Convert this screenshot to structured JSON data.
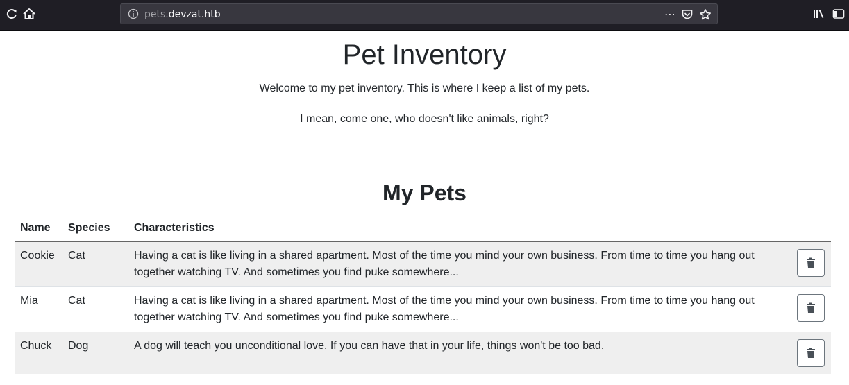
{
  "browser": {
    "url_host_prefix": "pets.",
    "url_host_domain": "devzat.htb",
    "more_actions": "⋯"
  },
  "page": {
    "title": "Pet Inventory",
    "intro_line1": "Welcome to my pet inventory. This is where I keep a list of my pets.",
    "intro_line2": "I mean, come one, who doesn't like animals, right?",
    "section_title": "My Pets"
  },
  "table": {
    "headers": [
      "Name",
      "Species",
      "Characteristics"
    ],
    "rows": [
      {
        "name": "Cookie",
        "species": "Cat",
        "characteristics": "Having a cat is like living in a shared apartment. Most of the time you mind your own business. From time to time you hang out together watching TV. And sometimes you find puke somewhere..."
      },
      {
        "name": "Mia",
        "species": "Cat",
        "characteristics": "Having a cat is like living in a shared apartment. Most of the time you mind your own business. From time to time you hang out together watching TV. And sometimes you find puke somewhere..."
      },
      {
        "name": "Chuck",
        "species": "Dog",
        "characteristics": "A dog will teach you unconditional love. If you can have that in your life, things won't be too bad."
      }
    ]
  },
  "icons": {
    "reload": "reload-icon",
    "home": "home-icon",
    "info": "info-icon",
    "pocket": "pocket-icon",
    "bookmark": "star-icon",
    "library": "library-icon",
    "sidebar": "sidebar-icon",
    "delete": "trash-icon"
  },
  "colors": {
    "toolbar_bg": "#1f1e25",
    "urlbar_bg": "#38373f",
    "stripe_bg": "#efefef"
  }
}
